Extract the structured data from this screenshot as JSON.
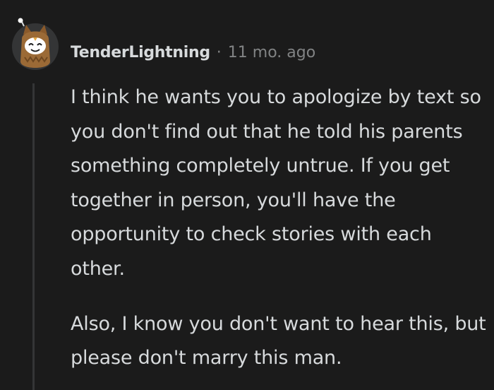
{
  "comment": {
    "username": "TenderLightning",
    "separator": "·",
    "timestamp": "11 mo. ago",
    "avatar_icon": "owl-snoo-avatar-icon",
    "paragraphs": [
      "I think he wants you to apologize by text so you don't find out that he told his parents something completely untrue. If you get together in person, you'll have the opportunity to check stories with each other.",
      "Also, I know you don't want to hear this, but please don't marry this man."
    ]
  },
  "colors": {
    "background": "#1b1b1b",
    "text": "#d7dadc",
    "meta": "#818384",
    "thread_line": "#343536"
  }
}
